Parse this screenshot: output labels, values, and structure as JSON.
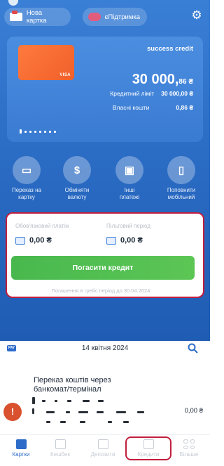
{
  "header": {
    "new_card_label": "Нова картка",
    "support_label": "єПідтримка"
  },
  "card": {
    "product_label": "success credit",
    "brand": "VISA",
    "balance_main": "30 000,",
    "balance_fraction": "86 ₴",
    "credit_limit_label": "Кредитний ліміт",
    "credit_limit_value": "30 000,00 ₴",
    "own_funds_label": "Власні кошти",
    "own_funds_value": "0,86 ₴"
  },
  "actions": [
    {
      "label": "Переказ на\nкартку",
      "icon": "card-transfer-icon"
    },
    {
      "label": "Обміняти\nвалюту",
      "icon": "currency-exchange-icon"
    },
    {
      "label": "Інші\nплатежі",
      "icon": "payments-icon"
    },
    {
      "label": "Поповнити\nмобільний",
      "icon": "mobile-icon"
    }
  ],
  "credit_panel": {
    "mandatory_label": "Обов'язковий платіж",
    "mandatory_value": "0,00 ₴",
    "grace_label": "Пільговий період",
    "grace_value": "0,00 ₴",
    "pay_button": "Погасити кредит",
    "note": "Погашення в грейс період до 30.04.2024"
  },
  "feed": {
    "date": "14 квітня 2024",
    "transaction_title": "Переказ коштів через банкомат/термінал",
    "transaction_amount": "0,00 ₴"
  },
  "tabs": [
    {
      "label": "Картки",
      "active": true
    },
    {
      "label": "Кешбек",
      "active": false
    },
    {
      "label": "Депозити",
      "active": false
    },
    {
      "label": "Кредити",
      "active": false
    },
    {
      "label": "Більше",
      "active": false
    }
  ],
  "colors": {
    "primary": "#2d6cc8",
    "pay_button": "#4fbd50",
    "highlight": "#c21e3e",
    "card": "#f26a30"
  }
}
